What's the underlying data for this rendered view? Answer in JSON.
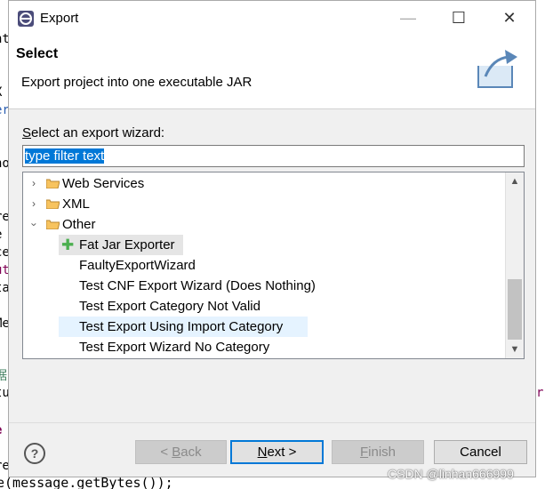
{
  "background": {
    "left_code_fragments": [
      "nt",
      "X",
      "er",
      "no",
      "re",
      "e",
      "ce",
      "ut",
      "ta",
      "Me",
      "据",
      "tu",
      "e",
      "re"
    ],
    "right_code_fragment": "r",
    "bottom_code": "e(message.getBytes());"
  },
  "window": {
    "title": "Export",
    "minimize_glyph": "—",
    "maximize_glyph": "☐",
    "close_glyph": "✕"
  },
  "header": {
    "title": "Select",
    "description": "Export project into one executable JAR"
  },
  "wizard": {
    "select_label": "Select an export wizard:",
    "select_label_mnemonic": "S",
    "select_label_rest": "elect an export wizard:",
    "filter_value": "type filter text"
  },
  "tree": {
    "items": [
      {
        "label": "Web Services",
        "type": "folder",
        "expanded": false
      },
      {
        "label": "XML",
        "type": "folder",
        "expanded": false
      },
      {
        "label": "Other",
        "type": "folder",
        "expanded": true
      },
      {
        "label": "Fat Jar Exporter",
        "type": "plugin",
        "icon": "plus-icon"
      },
      {
        "label": "FaultyExportWizard",
        "type": "item"
      },
      {
        "label": "Test CNF Export Wizard  (Does Nothing)",
        "type": "item"
      },
      {
        "label": "Test Export Category Not Valid",
        "type": "item"
      },
      {
        "label": "Test Export Using Import Category",
        "type": "item"
      },
      {
        "label": "Test Export Wizard No Category",
        "type": "item"
      }
    ]
  },
  "buttons": {
    "help": "?",
    "back_mnemonic": "B",
    "back_pre": "< ",
    "back_rest": "ack",
    "next_mnemonic": "N",
    "next_rest": "ext >",
    "finish_mnemonic": "F",
    "finish_rest": "inish",
    "cancel": "Cancel"
  },
  "watermark": "CSDN @linhan666999",
  "colors": {
    "selection": "#0078d7",
    "hover_row": "#e5f3ff",
    "folder": "#e8a33d",
    "plus": "#4caf50"
  }
}
